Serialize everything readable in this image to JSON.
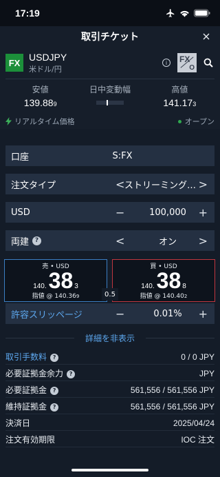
{
  "status": {
    "time": "17:19"
  },
  "header": {
    "title": "取引チケット"
  },
  "instrument": {
    "badge": "FX",
    "symbol": "USDJPY",
    "name": "米ドル/円",
    "logo_f": "FX",
    "logo_o": "O"
  },
  "prices": {
    "low_label": "安値",
    "low_main": "139.88",
    "low_sub": "9",
    "range_label": "日中変動幅",
    "high_label": "高値",
    "high_main": "141.17",
    "high_sub": "3"
  },
  "realtime": {
    "label": "リアルタイム価格",
    "market_status": "オープン"
  },
  "account": {
    "label": "口座",
    "value": "S:FX"
  },
  "order_type": {
    "label": "注文タイプ",
    "value": "ストリーミング…",
    "prev": "<",
    "next": ">"
  },
  "amount": {
    "label": "USD",
    "value": "100,000",
    "minus": "−",
    "plus": "+"
  },
  "both_sides": {
    "label": "両建",
    "value": "オン",
    "prev": "<",
    "next": ">"
  },
  "sell": {
    "side": "売 • USD",
    "pre": "140.",
    "big": "38",
    "post": "3",
    "limit": "指値 @ 140.36",
    "limit_sub": "9"
  },
  "buy": {
    "side": "買 • USD",
    "pre": "140.",
    "big": "38",
    "post": "8",
    "limit": "指値 @ 140.40",
    "limit_sub": "2"
  },
  "spread": "0.5",
  "slippage": {
    "label": "許容スリッページ",
    "value": "0.01%",
    "minus": "−",
    "plus": "+"
  },
  "details_toggle": "詳細を非表示",
  "details": [
    {
      "label": "取引手数料",
      "value": "0 / 0 JPY",
      "help": true
    },
    {
      "label": "必要証拠金余力",
      "value": "JPY",
      "help": true
    },
    {
      "label": "必要証拠金",
      "value": "561,556 / 561,556 JPY",
      "help": true
    },
    {
      "label": "維持証拠金",
      "value": "561,556 / 561,556 JPY",
      "help": true
    },
    {
      "label": "決済日",
      "value": "2025/04/24",
      "help": false
    },
    {
      "label": "注文有効期限",
      "value": "IOC 注文",
      "help": false
    }
  ],
  "colors": {
    "background": "#141c28",
    "row": "#243042",
    "sell_border": "#3b7fc4",
    "buy_border": "#c0363f",
    "link": "#5da7ee",
    "fx_badge": "#1c8f3a"
  },
  "icons": [
    "airplane-icon",
    "wifi-icon",
    "battery-icon",
    "close-icon",
    "info-icon",
    "search-icon",
    "lightning-icon",
    "help-icon"
  ]
}
